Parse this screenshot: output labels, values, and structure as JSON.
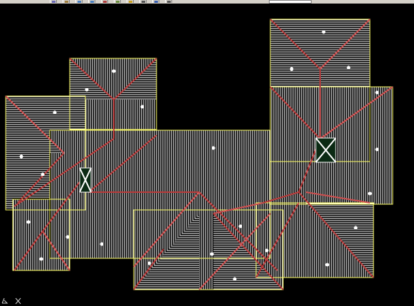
{
  "toolbar": {
    "buttons": [
      {
        "icon": "grid-icon",
        "color": "#6b6bb5"
      },
      {
        "icon": "pan-icon",
        "color": "#a08040"
      },
      {
        "icon": "zoom-window-icon",
        "color": "#4a7fbf"
      },
      {
        "icon": "zoom-previous-icon",
        "color": "#4a7fbf"
      },
      {
        "icon": "snap-icon",
        "color": "#b04040"
      },
      {
        "icon": "properties-icon",
        "color": "#6b8f3f"
      },
      {
        "icon": "layer-icon",
        "color": "#c9a020"
      },
      {
        "icon": "redo-icon",
        "color": "#555555"
      },
      {
        "icon": "help-icon",
        "color": "#3a60b0"
      },
      {
        "icon": "ortho-icon",
        "color": "#555555"
      }
    ],
    "layer_select_icon": "layer-dropdown-icon"
  },
  "drawing": {
    "background": "#000000",
    "outline_color": "#ffff66",
    "hatch_color": "#ffffff",
    "hip_color": "#b83a3a",
    "ridge_color": "#d05050",
    "dot_color": "#ffffff"
  },
  "ucs_icon": "ucs-axis-icon"
}
